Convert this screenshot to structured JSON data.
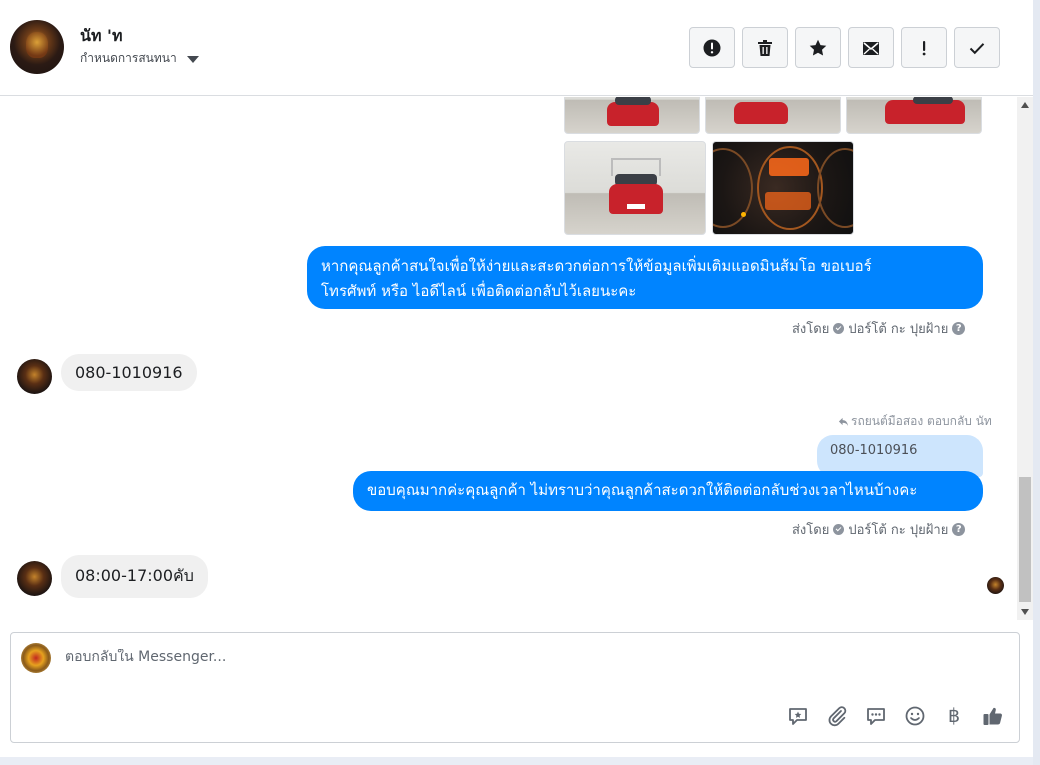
{
  "header": {
    "contact_name": "นัท 'ท",
    "subtitle": "กำหนดการสนทนา",
    "actions": [
      {
        "name": "mark-spam",
        "icon": "exclamation-circle-icon"
      },
      {
        "name": "delete",
        "icon": "trash-icon"
      },
      {
        "name": "star",
        "icon": "star-icon"
      },
      {
        "name": "mark-unread",
        "icon": "envelope-icon"
      },
      {
        "name": "flag",
        "icon": "exclamation-icon"
      },
      {
        "name": "done",
        "icon": "checkmark-icon"
      }
    ]
  },
  "thread": {
    "messages": [
      {
        "type": "outgoing",
        "text_line1": "หากคุณลูกค้าสนใจเพื่อให้ง่ายและสะดวกต่อการให้ข้อมูลเพิ่มเติมแอดมินส้มโอ ขอเบอร์",
        "text_line2": "โทรศัพท์ หรือ ไอดีไลน์ เพื่อติดต่อกลับไว้เลยนะคะ",
        "sent_by_label": "ส่งโดย",
        "sent_by_name": "ปอร์โต้ กะ ปุยฝ้าย"
      },
      {
        "type": "incoming",
        "text": "080-1010916"
      },
      {
        "type": "outgoing",
        "reply_note": "รถยนต์มือสอง ตอบกลับ นัท",
        "quoted_text": "080-1010916",
        "text": "ขอบคุณมากค่ะคุณลูกค้า ไม่ทราบว่าคุณลูกค้าสะดวกให้ติดต่อกลับช่วงเวลาไหนบ้างคะ",
        "sent_by_label": "ส่งโดย",
        "sent_by_name": "ปอร์โต้ กะ ปุยฝ้าย"
      },
      {
        "type": "incoming",
        "text": "08:00-17:00คับ"
      }
    ]
  },
  "composer": {
    "placeholder": "ตอบกลับใน Messenger...",
    "tools": [
      "saved-reply-icon",
      "attachment-icon",
      "chat-icon",
      "emoji-icon",
      "baht-icon",
      "thumbs-up-icon"
    ],
    "baht_symbol": "฿"
  },
  "colors": {
    "accent": "#0084ff",
    "incoming_bubble": "#f0f0f0",
    "quoted_bubble": "#cde5fd"
  }
}
